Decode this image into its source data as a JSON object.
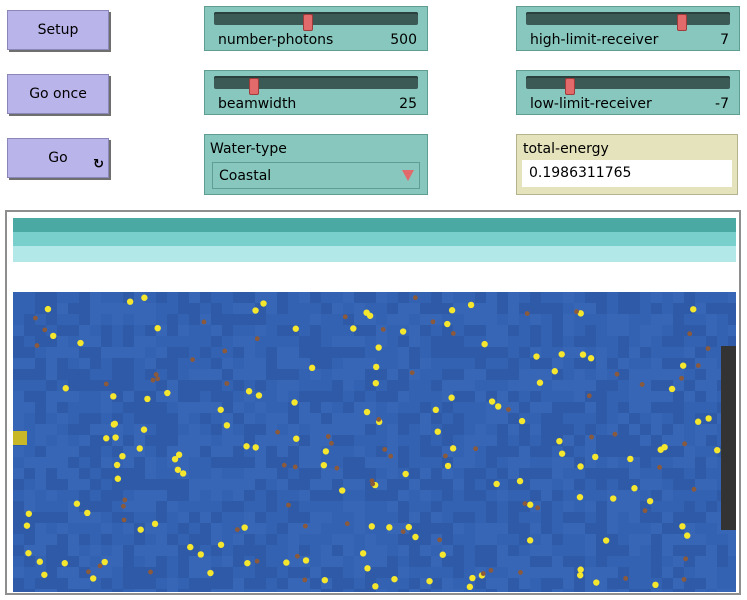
{
  "buttons": {
    "setup": "Setup",
    "go_once": "Go once",
    "go": "Go",
    "forever_icon": "↻"
  },
  "sliders": {
    "number_photons": {
      "label": "number-photons",
      "value": "500",
      "fraction": 0.46
    },
    "beamwidth": {
      "label": "beamwidth",
      "value": "25",
      "fraction": 0.18
    },
    "high_limit_receiver": {
      "label": "high-limit-receiver",
      "value": "7",
      "fraction": 0.78
    },
    "low_limit_receiver": {
      "label": "low-limit-receiver",
      "value": "-7",
      "fraction": 0.2
    }
  },
  "chooser": {
    "label": "Water-type",
    "selected": "Coastal"
  },
  "monitor": {
    "label": "total-energy",
    "value": "0.1986311765"
  },
  "view": {
    "colors": {
      "surface_bands": [
        "#4aa9a3",
        "#78cfcc",
        "#b3e8e8",
        "#ffffff"
      ],
      "water": "#3360b0",
      "photon": "#f5e62e",
      "absorbed": "#8b5a3c",
      "emitter": "#c8b827",
      "receiver": "#333333"
    }
  }
}
